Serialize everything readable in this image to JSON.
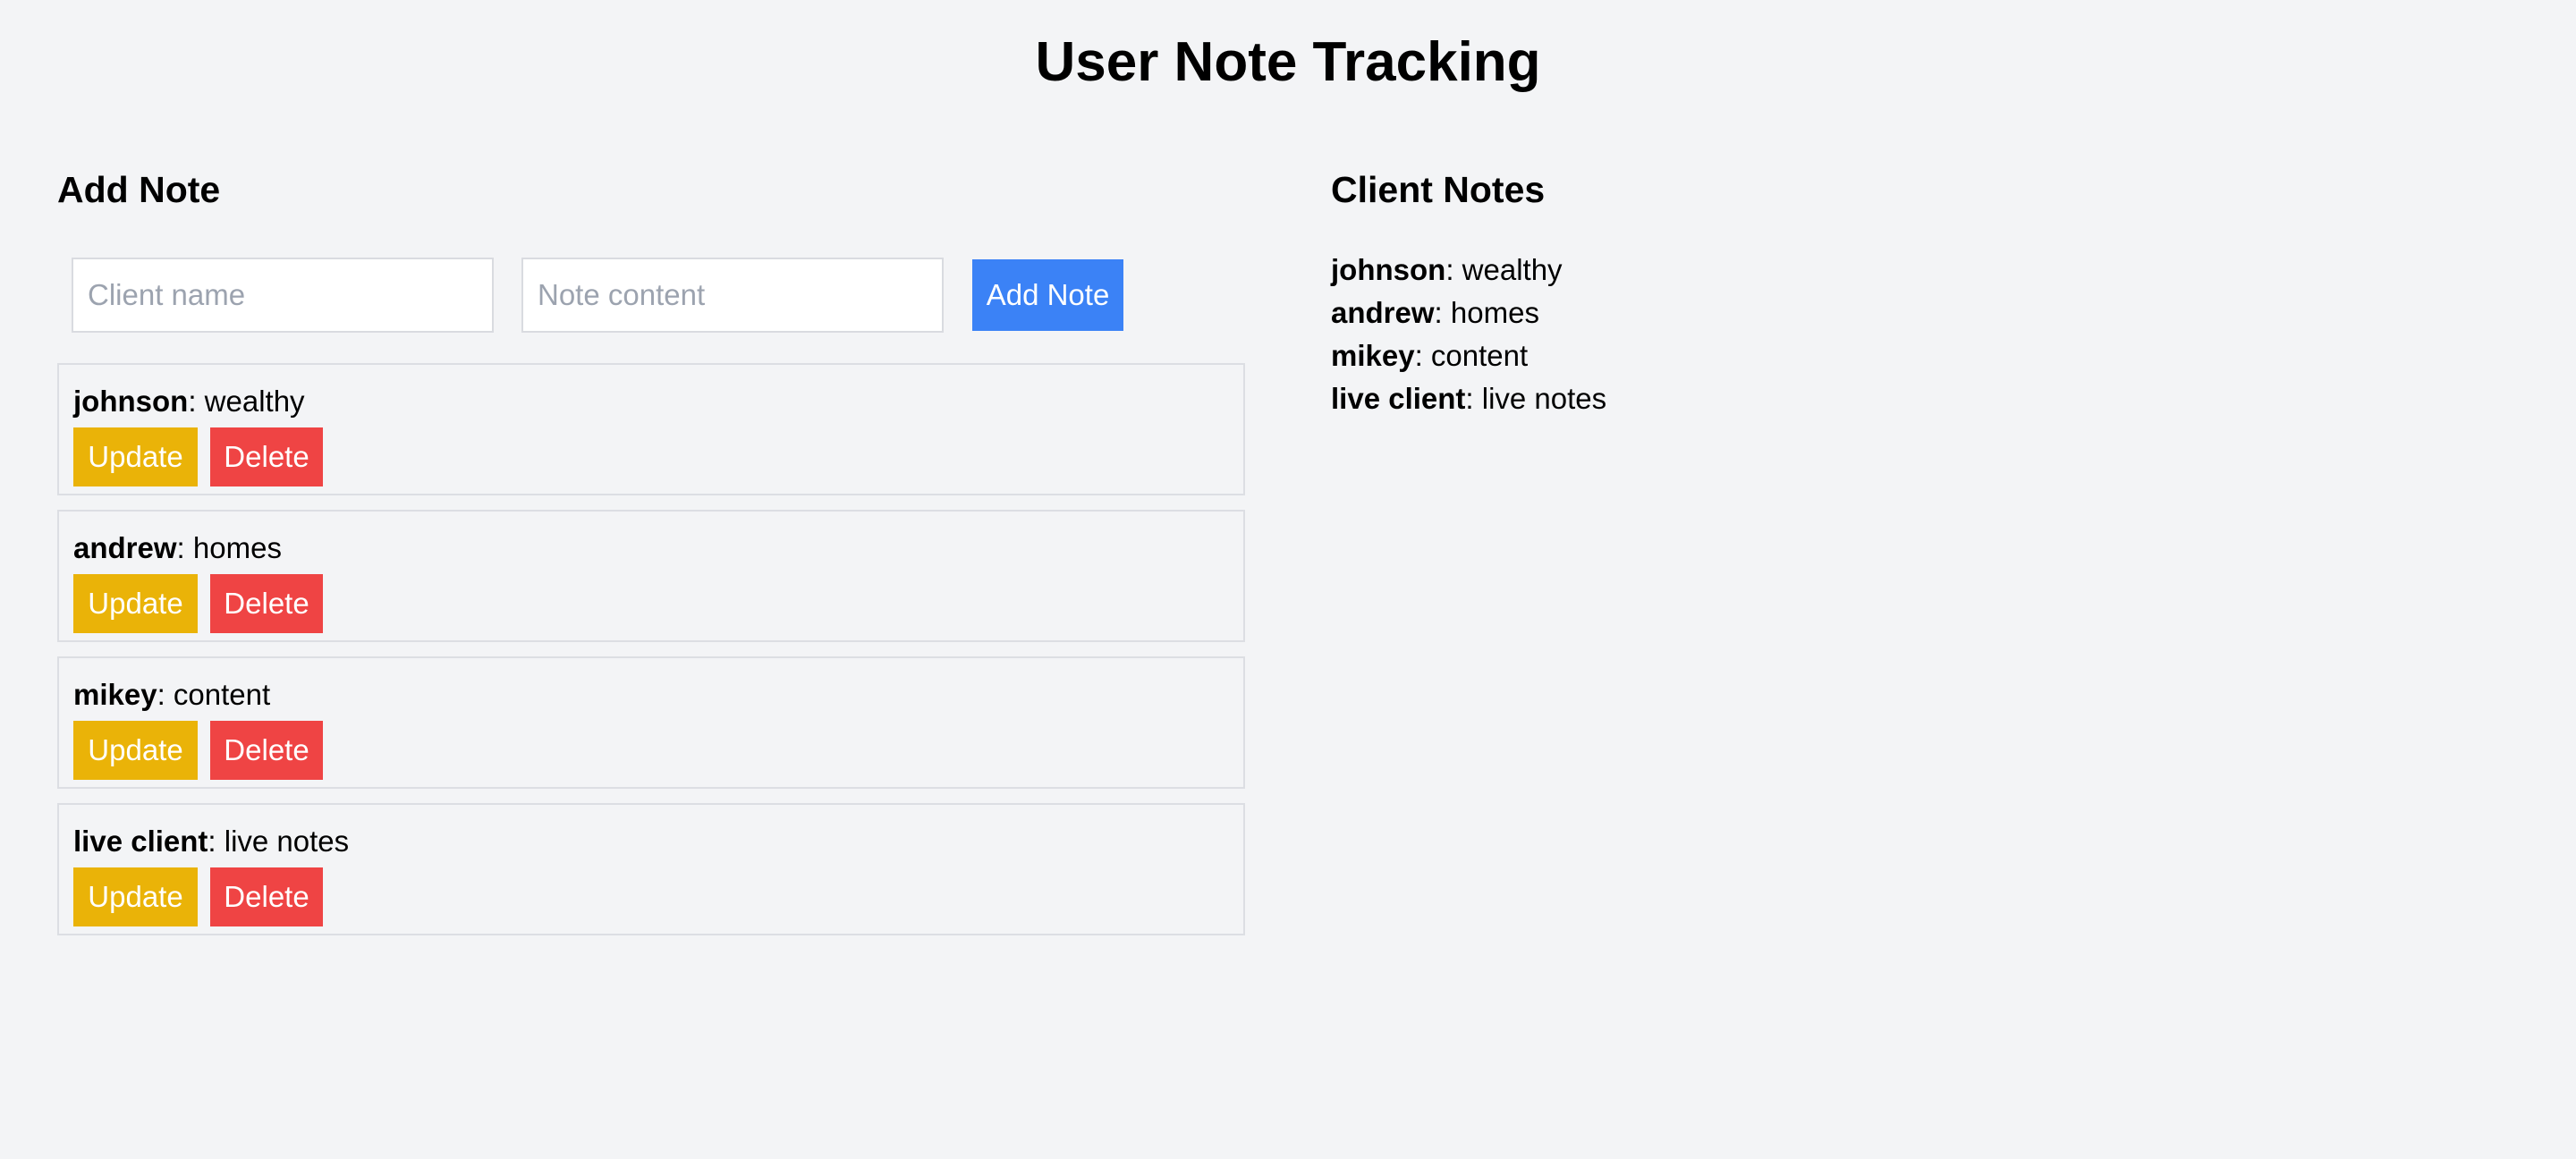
{
  "page": {
    "title": "User Note Tracking"
  },
  "add_note": {
    "title": "Add Note",
    "client_placeholder": "Client name",
    "client_value": "",
    "note_placeholder": "Note content",
    "note_value": "",
    "submit_label": "Add Note"
  },
  "notes": [
    {
      "client": "johnson",
      "separator": ": ",
      "content": "wealthy",
      "update_label": "Update",
      "delete_label": "Delete"
    },
    {
      "client": "andrew",
      "separator": ": ",
      "content": "homes",
      "update_label": "Update",
      "delete_label": "Delete"
    },
    {
      "client": "mikey",
      "separator": ": ",
      "content": "content",
      "update_label": "Update",
      "delete_label": "Delete"
    },
    {
      "client": "live client",
      "separator": ": ",
      "content": "live notes",
      "update_label": "Update",
      "delete_label": "Delete"
    }
  ],
  "client_notes": {
    "title": "Client Notes",
    "items": [
      {
        "client": "johnson",
        "separator": ": ",
        "content": "wealthy"
      },
      {
        "client": "andrew",
        "separator": ": ",
        "content": "homes"
      },
      {
        "client": "mikey",
        "separator": ": ",
        "content": "content"
      },
      {
        "client": "live client",
        "separator": ": ",
        "content": "live notes"
      }
    ]
  },
  "colors": {
    "background": "#f3f4f6",
    "primary": "#3b82f6",
    "update": "#eab308",
    "delete": "#ef4444"
  }
}
